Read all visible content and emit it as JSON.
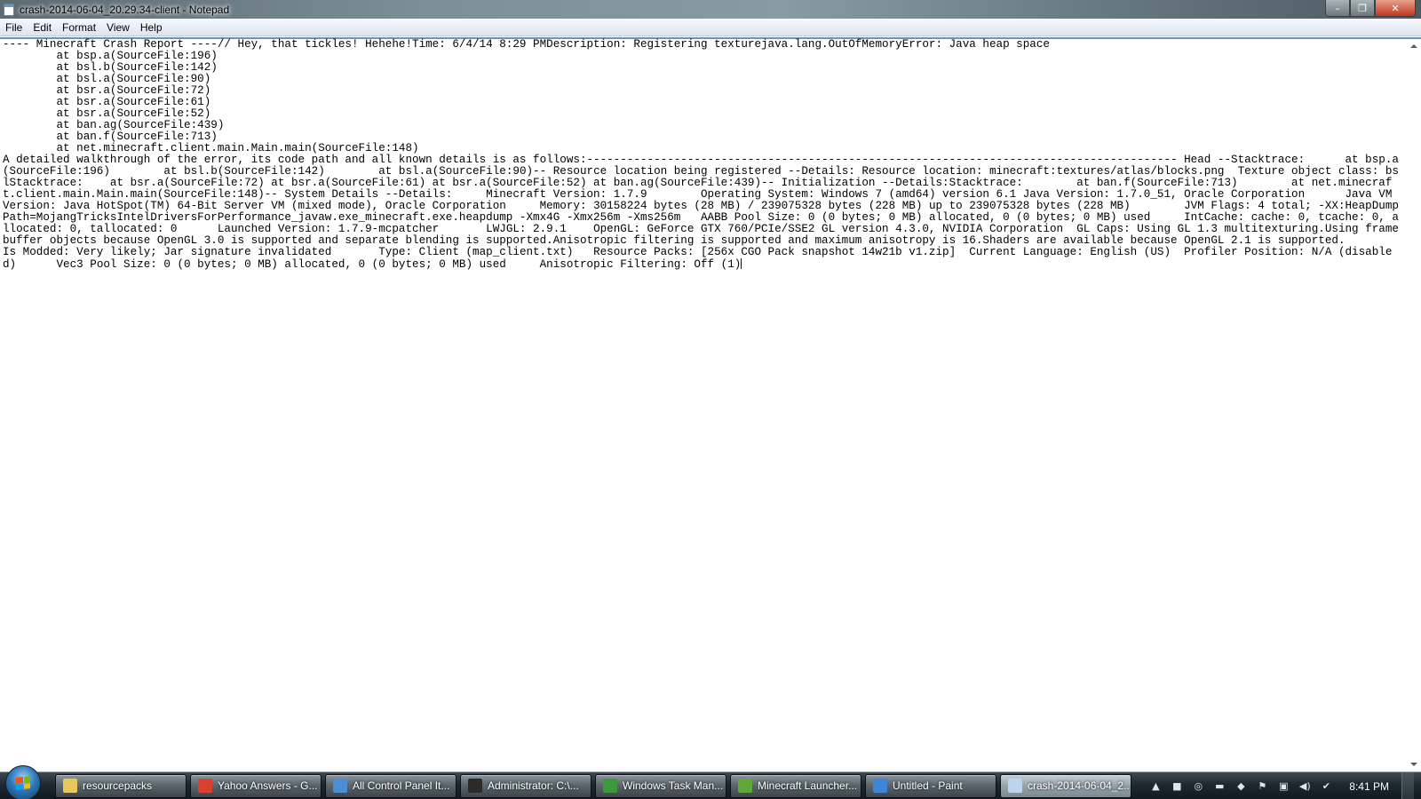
{
  "window": {
    "title": "crash-2014-06-04_20.29.34-client - Notepad",
    "app_icon": "notepad-icon",
    "controls": {
      "minimize": "–",
      "maximize": "❐",
      "close": "✕"
    }
  },
  "menubar": {
    "items": [
      {
        "label": "File",
        "accel": "F"
      },
      {
        "label": "Edit",
        "accel": "E"
      },
      {
        "label": "Format",
        "accel": "o"
      },
      {
        "label": "View",
        "accel": "V"
      },
      {
        "label": "Help",
        "accel": "H"
      }
    ]
  },
  "document": {
    "text": "---- Minecraft Crash Report ----// Hey, that tickles! Hehehe!Time: 6/4/14 8:29 PMDescription: Registering texturejava.lang.OutOfMemoryError: Java heap space\n\tat bsp.a(SourceFile:196)\n\tat bsl.b(SourceFile:142)\n\tat bsl.a(SourceFile:90)\n\tat bsr.a(SourceFile:72)\n\tat bsr.a(SourceFile:61)\n\tat bsr.a(SourceFile:52)\n\tat ban.ag(SourceFile:439)\n\tat ban.f(SourceFile:713)\n\tat net.minecraft.client.main.Main.main(SourceFile:148)\nA detailed walkthrough of the error, its code path and all known details is as follows:---------------------------------------------------------------------------------------- Head --Stacktrace:\tat bsp.a(SourceFile:196)\tat bsl.b(SourceFile:142)\tat bsl.a(SourceFile:90)-- Resource location being registered --Details: Resource location: minecraft:textures/atlas/blocks.png\tTexture object class: bslStacktrace:\tat bsr.a(SourceFile:72) at bsr.a(SourceFile:61) at bsr.a(SourceFile:52) at ban.ag(SourceFile:439)-- Initialization --Details:Stacktrace:\tat ban.f(SourceFile:713)\tat net.minecraft.client.main.Main.main(SourceFile:148)-- System Details --Details:\tMinecraft Version: 1.7.9\tOperating System: Windows 7 (amd64) version 6.1 Java Version: 1.7.0_51, Oracle Corporation\tJava VM Version: Java HotSpot(TM) 64-Bit Server VM (mixed mode), Oracle Corporation\tMemory: 30158224 bytes (28 MB) / 239075328 bytes (228 MB) up to 239075328 bytes (228 MB)\tJVM Flags: 4 total; -XX:HeapDumpPath=MojangTricksIntelDriversForPerformance_javaw.exe_minecraft.exe.heapdump -Xmx4G -Xmx256m -Xms256m\tAABB Pool Size: 0 (0 bytes; 0 MB) allocated, 0 (0 bytes; 0 MB) used\tIntCache: cache: 0, tcache: 0, allocated: 0, tallocated: 0\tLaunched Version: 1.7.9-mcpatcher\tLWJGL: 2.9.1\tOpenGL: GeForce GTX 760/PCIe/SSE2 GL version 4.3.0, NVIDIA Corporation\tGL Caps: Using GL 1.3 multitexturing.Using framebuffer objects because OpenGL 3.0 is supported and separate blending is supported.Anisotropic filtering is supported and maximum anisotropy is 16.Shaders are available because OpenGL 2.1 is supported.\tIs Modded: Very likely; Jar signature invalidated\tType: Client (map_client.txt)\tResource Packs: [256x CGO Pack snapshot 14w21b v1.zip]\tCurrent Language: English (US)\tProfiler Position: N/A (disabled)\tVec3 Pool Size: 0 (0 bytes; 0 MB) allocated, 0 (0 bytes; 0 MB) used\tAnisotropic Filtering: Off (1)"
  },
  "taskbar": {
    "start_icon": "windows-start-icon",
    "items": [
      {
        "label": "resourcepacks",
        "icon": "folder-icon",
        "color": "#e8c85a"
      },
      {
        "label": "Yahoo Answers - G...",
        "icon": "chrome-icon",
        "color": "#d9412f"
      },
      {
        "label": "All Control Panel It...",
        "icon": "control-panel-icon",
        "color": "#4a8fd6"
      },
      {
        "label": "Administrator: C:\\...",
        "icon": "cmd-icon",
        "color": "#2b2b2b"
      },
      {
        "label": "Windows Task Man...",
        "icon": "task-manager-icon",
        "color": "#3a9a3a"
      },
      {
        "label": "Minecraft Launcher...",
        "icon": "minecraft-icon",
        "color": "#5fa83a"
      },
      {
        "label": "Untitled - Paint",
        "icon": "paint-icon",
        "color": "#3c86d8"
      },
      {
        "label": "crash-2014-06-04_2...",
        "icon": "notepad-icon",
        "color": "#bcd4ec",
        "active": true
      }
    ],
    "tray": [
      {
        "icon": "show-hidden-icons-icon",
        "glyph": "▲"
      },
      {
        "icon": "green-app-icon",
        "glyph": "■"
      },
      {
        "icon": "steam-icon",
        "glyph": "◎"
      },
      {
        "icon": "nvidia-icon",
        "glyph": "▬"
      },
      {
        "icon": "color-app-icon",
        "glyph": "◆"
      },
      {
        "icon": "action-center-flag-icon",
        "glyph": "⚑"
      },
      {
        "icon": "network-icon",
        "glyph": "▣"
      },
      {
        "icon": "volume-icon",
        "glyph": "◀)"
      },
      {
        "icon": "safely-remove-icon",
        "glyph": "✔"
      }
    ],
    "clock": "8:41 PM"
  }
}
